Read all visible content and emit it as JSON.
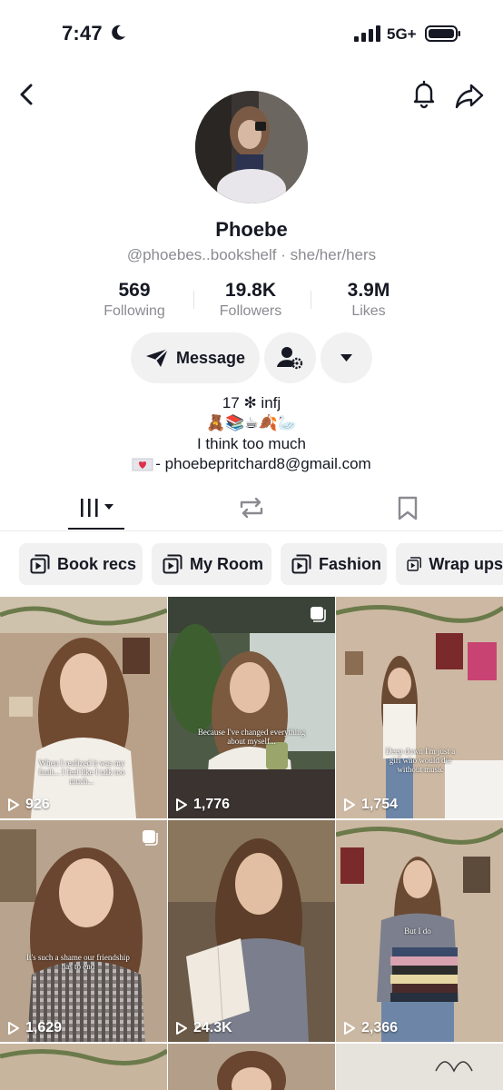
{
  "status": {
    "time": "7:47",
    "network": "5G+"
  },
  "profile": {
    "name": "Phoebe",
    "handle": "@phoebes..bookshelf",
    "separator": "·",
    "pronouns": "she/her/hers",
    "stats": [
      {
        "value": "569",
        "label": "Following"
      },
      {
        "value": "19.8K",
        "label": "Followers"
      },
      {
        "value": "3.9M",
        "label": "Likes"
      }
    ],
    "message_label": "Message",
    "bio": {
      "line1": "17 ✻ infj",
      "line2": "🧸📚☕🍂🦢",
      "line3": "I think too much",
      "email": "- phoebepritchard8@gmail.com"
    }
  },
  "playlists": [
    "Book recs",
    "My Room",
    "Fashion",
    "Wrap ups"
  ],
  "videos": [
    {
      "views": "926",
      "caption": "When I realized it was my fault... I feel like I talk too much..."
    },
    {
      "views": "1,776",
      "caption": "Because I've changed everything about myself..."
    },
    {
      "views": "1,754",
      "caption": "Deep down I'm just a girl who would die without music"
    },
    {
      "views": "1,629",
      "caption": "It's such a shame our friendship has to end"
    },
    {
      "views": "24.3K",
      "caption": ""
    },
    {
      "views": "2,366",
      "caption": "But I do"
    }
  ],
  "colors": {
    "text": "#161823",
    "muted": "#8a8b91",
    "chip": "#f1f1f2"
  }
}
